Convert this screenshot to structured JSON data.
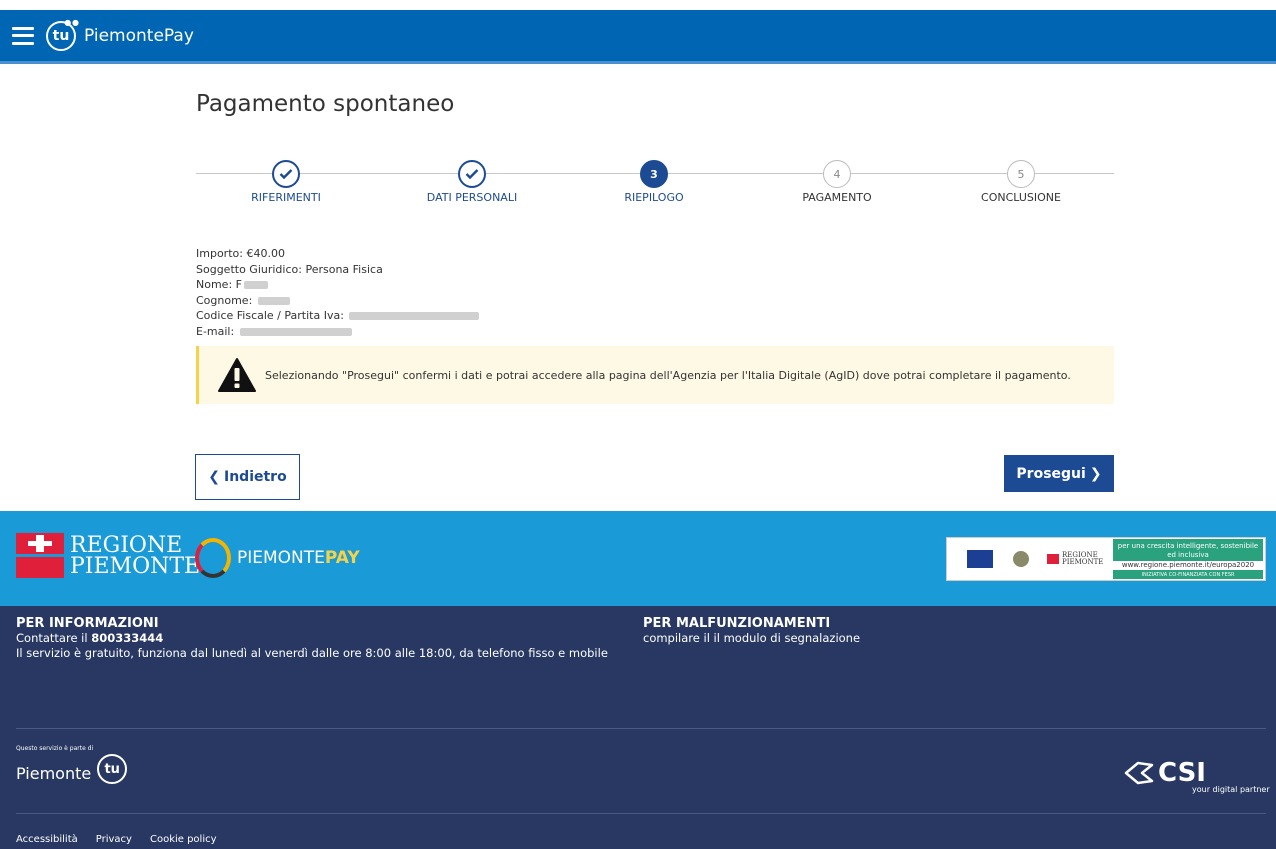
{
  "header": {
    "logo_text": "tu",
    "app_name": "PiemontePay"
  },
  "page": {
    "title": "Pagamento spontaneo"
  },
  "stepper": {
    "steps": [
      {
        "label": "RIFERIMENTI",
        "state": "done",
        "number": ""
      },
      {
        "label": "DATI PERSONALI",
        "state": "done",
        "number": ""
      },
      {
        "label": "RIEPILOGO",
        "state": "current",
        "number": "3"
      },
      {
        "label": "PAGAMENTO",
        "state": "future",
        "number": "4"
      },
      {
        "label": "CONCLUSIONE",
        "state": "future",
        "number": "5"
      }
    ]
  },
  "summary": {
    "importo_label": "Importo:",
    "importo_value": "€40.00",
    "soggetto_label": "Soggetto Giuridico:",
    "soggetto_value": "Persona Fisica",
    "nome_label": "Nome:",
    "nome_value": "F",
    "cognome_label": "Cognome:",
    "cognome_value": "",
    "cf_label": "Codice Fiscale / Partita Iva:",
    "cf_value": "",
    "email_label": "E-mail:",
    "email_value": ""
  },
  "warning": {
    "text": "Selezionando \"Prosegui\" confermi i dati e potrai accedere alla pagina dell'Agenzia per l'Italia Digitale (AgID) dove potrai completare il pagamento."
  },
  "actions": {
    "back_label": "Indietro",
    "next_label": "Prosegui"
  },
  "brand": {
    "regione_line1": "REGIONE",
    "regione_line2": "PIEMONTE",
    "piemontepay_a": "PIEMONTE",
    "piemontepay_b": "PAY",
    "eu_regione": "REGIONE PIEMONTE",
    "eu_slogan": "per una crescita intelligente, sostenibile ed inclusiva",
    "eu_url": "www.regione.piemonte.it/europa2020",
    "eu_note": "INIZIATIVA CO-FINANZIATA CON FESR"
  },
  "footer": {
    "info_title": "PER INFORMAZIONI",
    "info_contact_prefix": "Contattare il ",
    "info_phone": "800333444",
    "info_hours": "Il servizio è gratuito, funziona dal lunedì al venerdì dalle ore 8:00 alle 18:00, da telefono fisso e mobile",
    "malf_title": "PER MALFUNZIONAMENTI",
    "malf_text": "compilare il il modulo di segnalazione",
    "service_caption": "Questo servizio è parte di",
    "service_name": "Piemonte",
    "service_logo": "tu",
    "csi_word": "CSI",
    "csi_tag": "your digital partner",
    "links": [
      "Accessibilità",
      "Privacy",
      "Cookie policy"
    ]
  },
  "colors": {
    "header_bg": "#0066b3",
    "primary": "#1c4b94",
    "brand_band": "#1b9ad8",
    "footer_bg": "#283862",
    "warning_bg": "#fdf9e4",
    "warning_border": "#f4d24a"
  }
}
